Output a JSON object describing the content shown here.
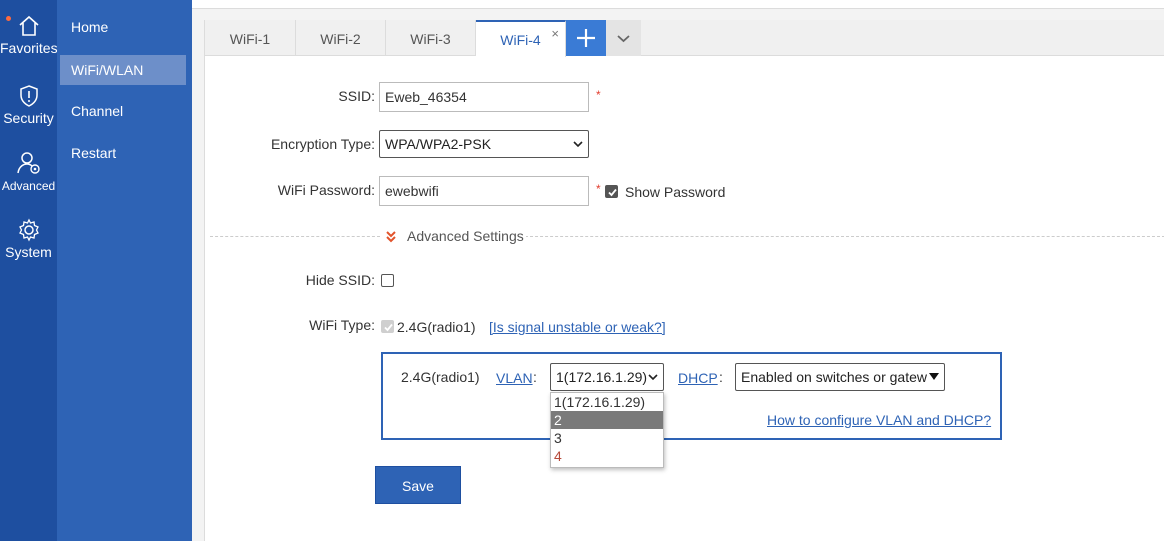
{
  "rail": {
    "items": [
      {
        "label": "Favorites",
        "icon": "home-icon"
      },
      {
        "label": "Security",
        "icon": "shield-icon"
      },
      {
        "label": "Advanced",
        "icon": "user-gear-icon"
      },
      {
        "label": "System",
        "icon": "gear-icon"
      }
    ]
  },
  "nav": {
    "items": [
      {
        "label": "Home"
      },
      {
        "label": "WiFi/WLAN",
        "active": true
      },
      {
        "label": "Channel"
      },
      {
        "label": "Restart"
      }
    ]
  },
  "tabs": [
    {
      "label": "WiFi-1"
    },
    {
      "label": "WiFi-2"
    },
    {
      "label": "WiFi-3"
    },
    {
      "label": "WiFi-4",
      "active": true,
      "close": "×"
    }
  ],
  "form": {
    "ssid_label": "SSID:",
    "ssid_value": "Eweb_46354",
    "required_mark": "*",
    "encryption_label": "Encryption Type:",
    "encryption_value": "WPA/WPA2-PSK",
    "password_label": "WiFi Password:",
    "password_value": "ewebwifi",
    "show_password_label": "Show Password",
    "show_password_checked": true,
    "advanced_label": "Advanced Settings",
    "hide_ssid_label": "Hide SSID:",
    "hide_ssid_checked": false,
    "wifi_type_label": "WiFi Type:",
    "wifi_type_value": "2.4G(radio1)",
    "signal_link": "[Is signal unstable or weak?]"
  },
  "radio_panel": {
    "radio_label": "2.4G(radio1)",
    "vlan_link": "VLAN",
    "colon": ":",
    "vlan_value": "1(172.16.1.29)",
    "dhcp_link": "DHCP",
    "dhcp_value": "Enabled on switches or gatewa",
    "help_link": "How to configure VLAN and DHCP?",
    "vlan_options": [
      "1(172.16.1.29)",
      "2",
      "3",
      "4"
    ],
    "highlighted_option": "2"
  },
  "save_label": "Save",
  "colors": {
    "rail": "#1e4fa0",
    "nav": "#2e63b5",
    "accent": "#2e63b5",
    "required": "#e23d2e"
  }
}
